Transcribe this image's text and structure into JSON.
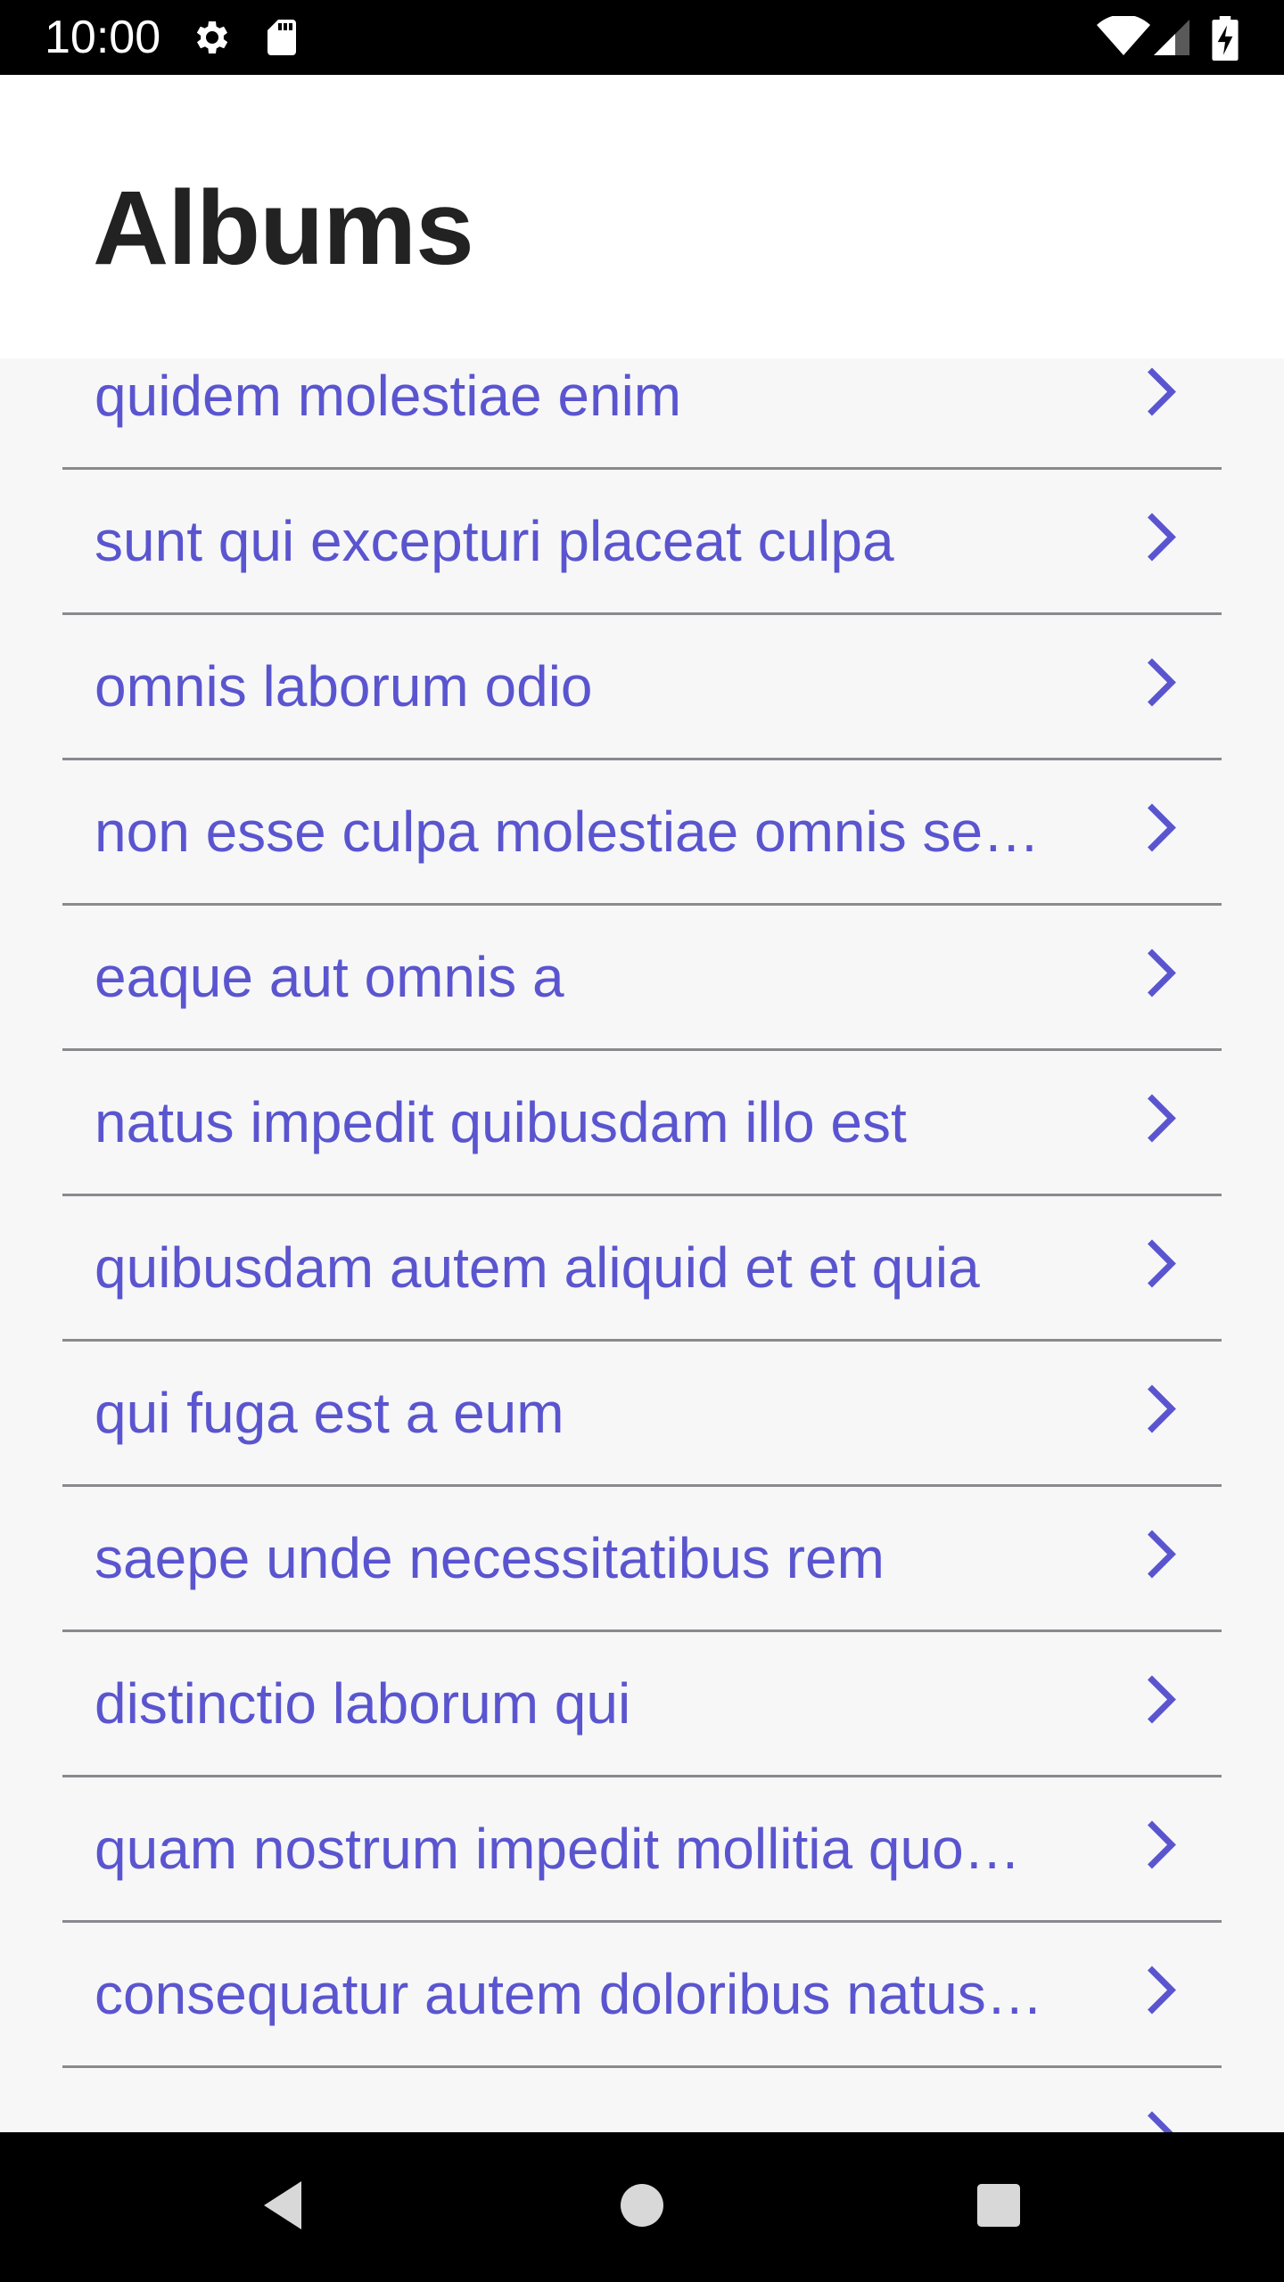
{
  "status_bar": {
    "time": "10:00",
    "icons": [
      "gear-icon",
      "sd-card-icon",
      "wifi-icon",
      "signal-icon",
      "battery-icon"
    ]
  },
  "header": {
    "title": "Albums"
  },
  "albums": [
    {
      "label": "quidem molestiae enim"
    },
    {
      "label": "sunt qui excepturi placeat culpa"
    },
    {
      "label": "omnis laborum odio"
    },
    {
      "label": "non esse culpa molestiae omnis se…"
    },
    {
      "label": "eaque aut omnis a"
    },
    {
      "label": "natus impedit quibusdam illo est"
    },
    {
      "label": "quibusdam autem aliquid et et quia"
    },
    {
      "label": "qui fuga est a eum"
    },
    {
      "label": "saepe unde necessitatibus rem"
    },
    {
      "label": "distinctio laborum qui"
    },
    {
      "label": "quam nostrum impedit mollitia quo…"
    },
    {
      "label": "consequatur autem doloribus natus…"
    },
    {
      "label": ""
    }
  ],
  "colors": {
    "accent": "#5a55cf",
    "title": "#222222",
    "divider": "#8a8a8e",
    "list_background": "#f7f7f8"
  },
  "nav_bar": {
    "icons": [
      "back-icon",
      "home-icon",
      "recents-icon"
    ]
  }
}
